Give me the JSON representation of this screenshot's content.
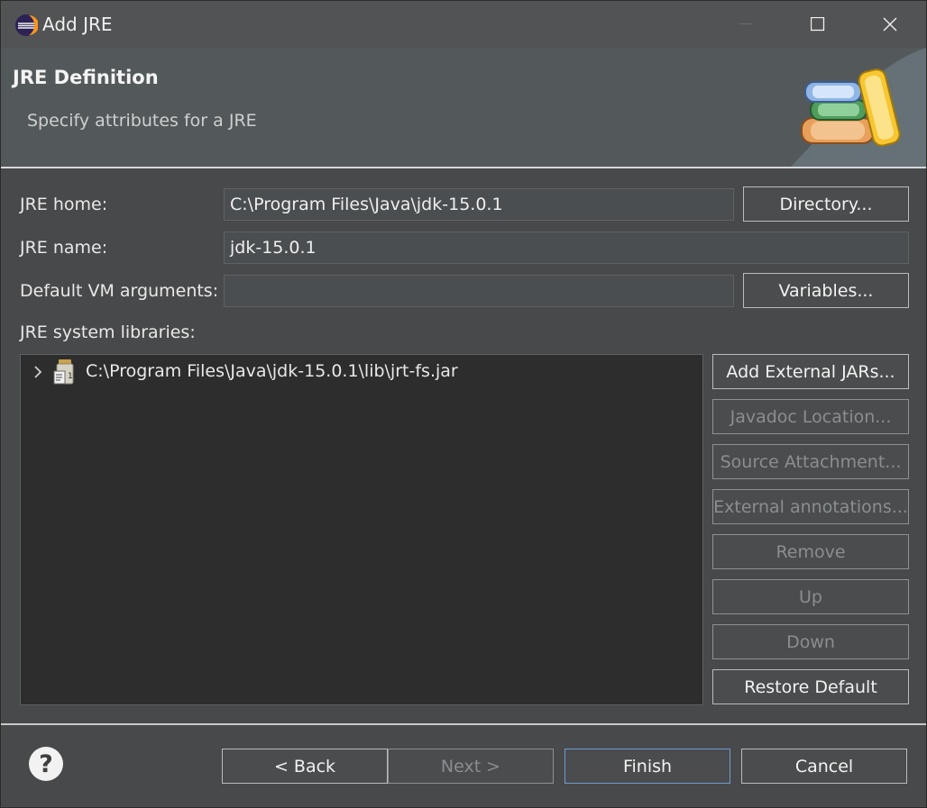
{
  "window": {
    "title": "Add JRE",
    "icon": "eclipse-icon",
    "controls": {
      "minimize": "minimize-icon",
      "maximize": "maximize-icon",
      "close": "close-icon"
    }
  },
  "banner": {
    "title": "JRE Definition",
    "message": "Specify attributes for a JRE",
    "image": "library-books-icon"
  },
  "form": {
    "jre_home": {
      "label": "JRE home:",
      "value": "C:\\Program Files\\Java\\jdk-15.0.1",
      "button": "Directory..."
    },
    "jre_name": {
      "label": "JRE name:",
      "value": "jdk-15.0.1"
    },
    "vm_args": {
      "label": "Default VM arguments:",
      "value": "",
      "button": "Variables..."
    },
    "libraries": {
      "label": "JRE system libraries:",
      "items": [
        {
          "label": "C:\\Program Files\\Java\\jdk-15.0.1\\lib\\jrt-fs.jar",
          "icon": "jar-library-icon",
          "expanded": false
        }
      ]
    }
  },
  "library_buttons": [
    {
      "label": "Add External JARs...",
      "enabled": true
    },
    {
      "label": "Javadoc Location...",
      "enabled": false
    },
    {
      "label": "Source Attachment...",
      "enabled": false
    },
    {
      "label": "External annotations...",
      "enabled": false
    },
    {
      "label": "Remove",
      "enabled": false
    },
    {
      "label": "Up",
      "enabled": false
    },
    {
      "label": "Down",
      "enabled": false
    },
    {
      "label": "Restore Default",
      "enabled": true
    }
  ],
  "footer": {
    "help": "?",
    "back": "< Back",
    "next": "Next >",
    "finish": "Finish",
    "cancel": "Cancel"
  },
  "colors": {
    "background": "#48494b",
    "banner": "#53585b",
    "list_background": "#2d2d2d",
    "focus_border": "#6f9bd0",
    "disabled_text": "#8b8e90"
  }
}
